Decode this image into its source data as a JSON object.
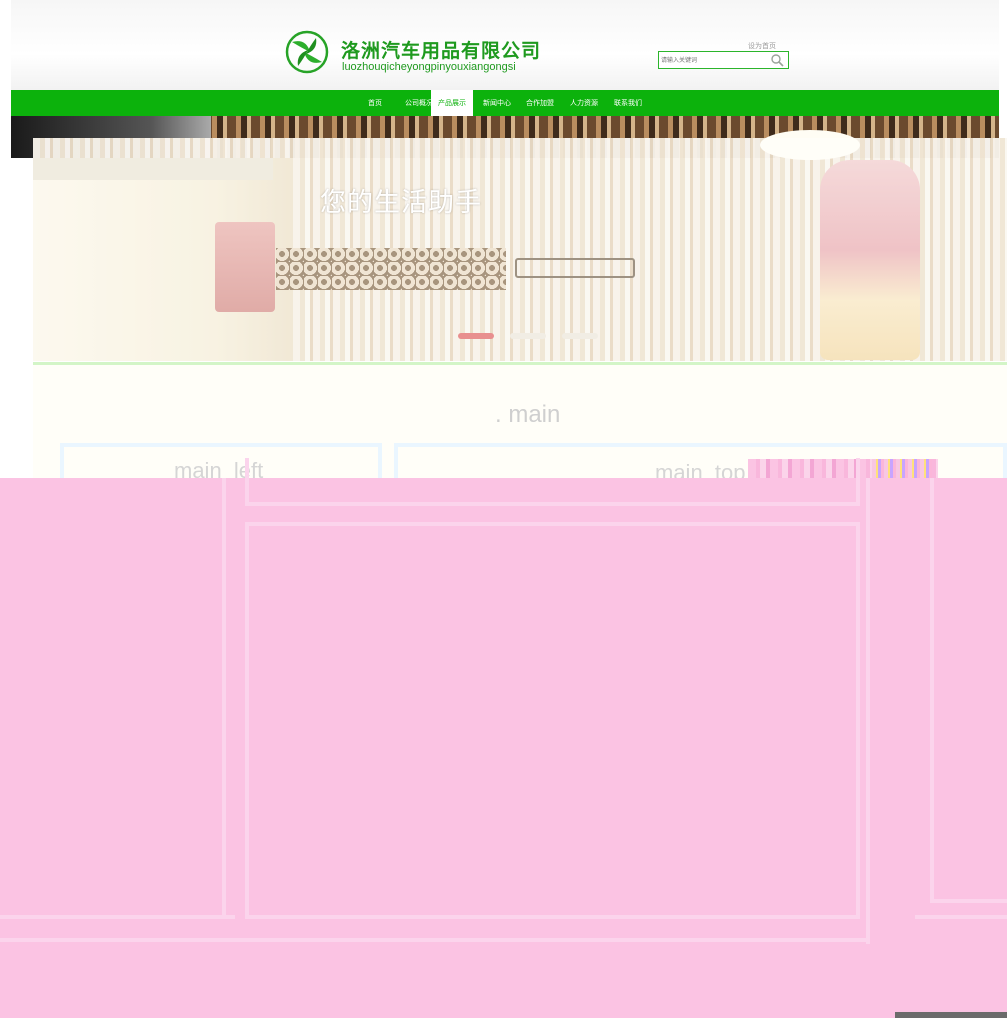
{
  "header": {
    "company_name_cn": "洛洲汽车用品有限公司",
    "company_name_pinyin": "luozhouqicheyongpinyouxiangongsi",
    "top_link": "设为首页",
    "search_placeholder": "请输入关键词",
    "logo_icon": "swirl-leaf-logo",
    "search_icon": "magnifier-icon",
    "brand_color": "#0cb20c"
  },
  "nav": {
    "items": [
      {
        "label": "首页"
      },
      {
        "label": "公司概况"
      },
      {
        "label": "产品展示"
      },
      {
        "label": "新闻中心"
      },
      {
        "label": "合作加盟"
      },
      {
        "label": "人力资源"
      },
      {
        "label": "联系我们"
      }
    ],
    "active_index": 2
  },
  "banner": {
    "slogan": "您的生活助手",
    "slide_count": 3,
    "active_slide": 1
  },
  "layout": {
    "main_label": ". main",
    "main_left_label": "main_left",
    "main_top_label": "main_top"
  },
  "colors": {
    "overlay_pink": "#fbc3e3",
    "nav_green": "#0cb20c"
  }
}
